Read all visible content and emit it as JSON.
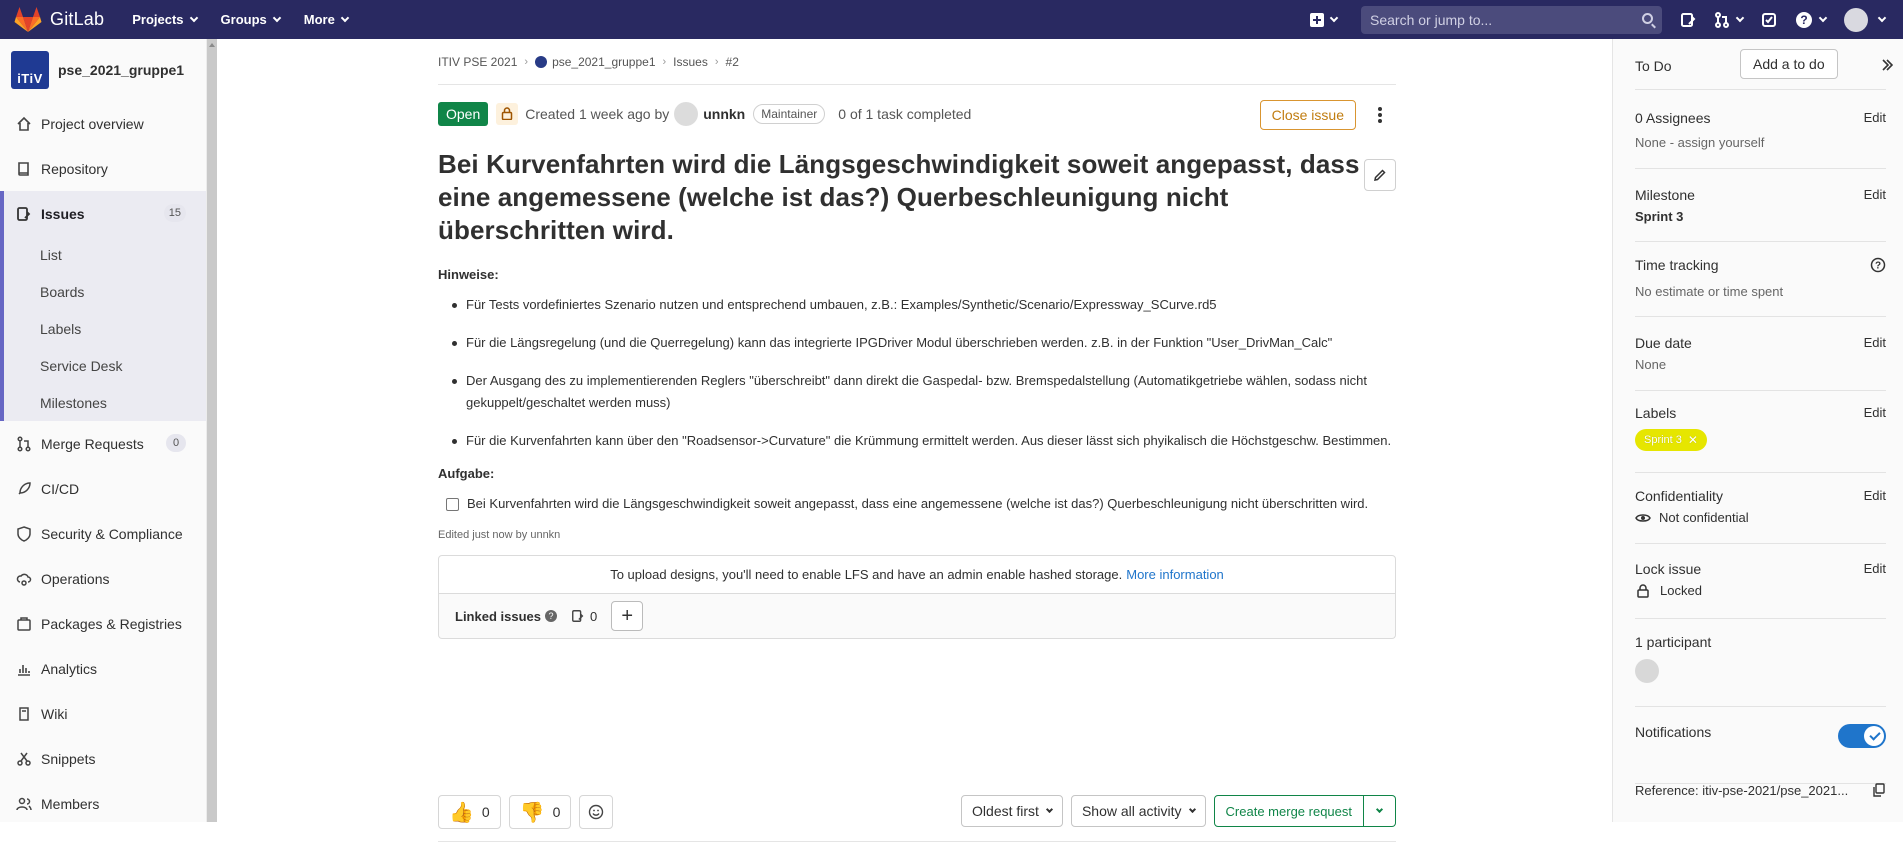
{
  "topbar": {
    "brand": "GitLab",
    "nav": [
      "Projects",
      "Groups",
      "More"
    ],
    "search_placeholder": "Search or jump to..."
  },
  "sidebar": {
    "project_name": "pse_2021_gruppe1",
    "avatar_text": "iTiV",
    "items": [
      {
        "label": "Project overview",
        "icon": "home-icon"
      },
      {
        "label": "Repository",
        "icon": "book-icon"
      },
      {
        "label": "Issues",
        "icon": "issues-icon",
        "count": "15"
      },
      {
        "label": "Merge Requests",
        "icon": "merge-request-icon",
        "count": "0"
      },
      {
        "label": "CI/CD",
        "icon": "rocket-icon"
      },
      {
        "label": "Security & Compliance",
        "icon": "shield-icon"
      },
      {
        "label": "Operations",
        "icon": "cloud-gear-icon"
      },
      {
        "label": "Packages & Registries",
        "icon": "package-icon"
      },
      {
        "label": "Analytics",
        "icon": "chart-icon"
      },
      {
        "label": "Wiki",
        "icon": "wiki-icon"
      },
      {
        "label": "Snippets",
        "icon": "scissors-icon"
      },
      {
        "label": "Members",
        "icon": "users-icon"
      }
    ],
    "issues_sub": [
      "List",
      "Boards",
      "Labels",
      "Service Desk",
      "Milestones"
    ]
  },
  "breadcrumb": [
    "ITIV PSE 2021",
    "pse_2021_gruppe1",
    "Issues",
    "#2"
  ],
  "issue": {
    "status": "Open",
    "created": "Created 1 week ago by",
    "author": "unnkn",
    "role": "Maintainer",
    "tasks": "0 of 1 task completed",
    "close_label": "Close issue",
    "title": "Bei Kurvenfahrten wird die Längsgeschwindigkeit soweit angepasst, dass eine angemessene (welche ist das?) Querbeschleunigung nicht überschritten wird.",
    "hints_heading": "Hinweise:",
    "hints": [
      "Für Tests vordefiniertes Szenario nutzen und entsprechend umbauen, z.B.: Examples/Synthetic/Scenario/Expressway_SCurve.rd5",
      "Für die Längsregelung (und die Querregelung) kann das integrierte IPGDriver Modul überschrieben werden. z.B. in der Funktion \"User_DrivMan_Calc\"",
      "Der Ausgang des zu implementierenden Reglers \"überschreibt\" dann direkt die Gaspedal- bzw. Bremspedalstellung (Automatikgetriebe wählen, sodass nicht gekuppelt/geschaltet werden muss)",
      "Für die Kurvenfahrten kann über den \"Roadsensor->Curvature\" die Krümmung ermittelt werden. Aus dieser lässt sich phyikalisch die Höchstgeschw. Bestimmen."
    ],
    "task_heading": "Aufgabe:",
    "task": "Bei Kurvenfahrten wird die Längsgeschwindigkeit soweit angepasst, dass eine angemessene (welche ist das?) Querbeschleunigung nicht überschritten wird.",
    "edited": "Edited just now by unnkn",
    "upload_text": "To upload designs, you'll need to enable LFS and have an admin enable hashed storage.",
    "upload_link": "More information",
    "linked_label": "Linked issues",
    "linked_count": "0",
    "thumbs_up": "0",
    "thumbs_down": "0",
    "sort_label": "Oldest first",
    "activity_label": "Show all activity",
    "create_mr": "Create merge request"
  },
  "right": {
    "todo": "To Do",
    "add_todo": "Add a to do",
    "assignees_title": "0 Assignees",
    "assignees_value": "None - assign yourself",
    "milestone_title": "Milestone",
    "milestone_value": "Sprint 3",
    "time_title": "Time tracking",
    "time_value": "No estimate or time spent",
    "due_title": "Due date",
    "due_value": "None",
    "labels_title": "Labels",
    "label_pill": "Sprint 3",
    "label_color": "#e6e600",
    "conf_title": "Confidentiality",
    "conf_value": "Not confidential",
    "lock_title": "Lock issue",
    "lock_value": "Locked",
    "participants": "1 participant",
    "notifications": "Notifications",
    "reference": "Reference: itiv-pse-2021/pse_2021...",
    "edit": "Edit"
  }
}
